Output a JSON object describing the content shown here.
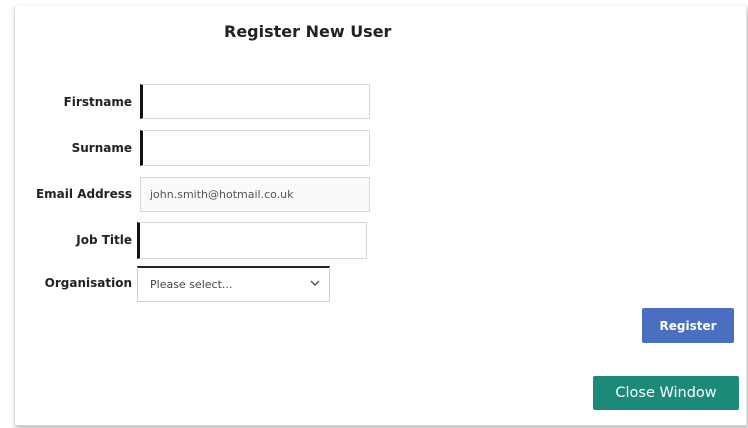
{
  "dialog": {
    "title": "Register New User"
  },
  "form": {
    "firstname": {
      "label": "Firstname",
      "value": ""
    },
    "surname": {
      "label": "Surname",
      "value": ""
    },
    "email": {
      "label": "Email Address",
      "value": "john.smith@hotmail.co.uk"
    },
    "job_title": {
      "label": "Job Title",
      "value": ""
    },
    "organisation": {
      "label": "Organisation",
      "selected": "Please select..."
    }
  },
  "buttons": {
    "register_label": "Register",
    "close_label": "Close Window"
  },
  "icons": {
    "select_arrow": "chevron-down-icon"
  },
  "colors": {
    "register_button": "#4a6fc0",
    "close_button": "#1b8a78"
  }
}
